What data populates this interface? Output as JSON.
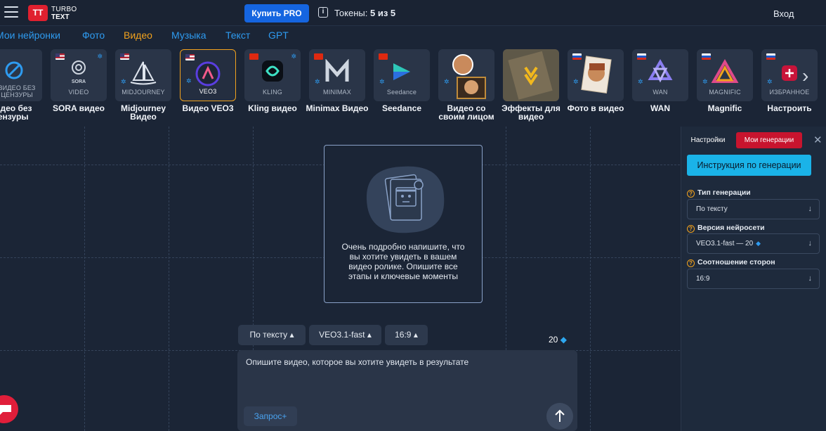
{
  "header": {
    "logo_mark": "TT",
    "logo_line1": "TURBO",
    "logo_line2": "TEXT",
    "buy_label": "Купить PRO",
    "tokens_label": "Токены:",
    "tokens_value": "5 из 5",
    "login_label": "Вход"
  },
  "categories": [
    {
      "label": "Мои нейронки",
      "active": false
    },
    {
      "label": "Фото",
      "active": false
    },
    {
      "label": "Видео",
      "active": true
    },
    {
      "label": "Музыка",
      "active": false
    },
    {
      "label": "Текст",
      "active": false
    },
    {
      "label": "GPT",
      "active": false
    }
  ],
  "tools": [
    {
      "tag": "ВИДЕО БЕЗ ЦЕНЗУРЫ",
      "label": "Видео без цензуры",
      "icon": "no-censor-icon"
    },
    {
      "tag": "VIDEO",
      "label": "SORA видео",
      "icon": "sora-icon"
    },
    {
      "tag": "MIDJOURNEY",
      "label": "Midjourney Видео",
      "icon": "midjourney-icon"
    },
    {
      "tag": "VEO3",
      "label": "Видео VEO3",
      "icon": "veo3-icon",
      "selected": true
    },
    {
      "tag": "KLING",
      "label": "Kling видео",
      "icon": "kling-icon"
    },
    {
      "tag": "MINIMAX",
      "label": "Minimax Видео",
      "icon": "minimax-icon"
    },
    {
      "tag": "Seedance",
      "label": "Seedance",
      "icon": "seedance-icon"
    },
    {
      "tag": "",
      "label": "Видео со своим лицом",
      "icon": "face-video-icon"
    },
    {
      "tag": "",
      "label": "Эффекты для видео",
      "icon": "effects-icon"
    },
    {
      "tag": "",
      "label": "Фото в видео",
      "icon": "photo-to-video-icon"
    },
    {
      "tag": "WAN",
      "label": "WAN",
      "icon": "wan-icon"
    },
    {
      "tag": "MAGNIFIC",
      "label": "Magnific",
      "icon": "magnific-icon"
    },
    {
      "tag": "ИЗБРАННОЕ",
      "label": "Настроить",
      "icon": "favorites-icon"
    }
  ],
  "sora_small": "SORA",
  "canvas": {
    "placeholder_text": "Очень подробно напишите, что вы хотите увидеть в вашем видео ролике. Опишите все этапы и ключевые моменты"
  },
  "composer": {
    "mode_pill": "По тексту",
    "model_pill": "VEO3.1-fast",
    "ratio_pill": "16:9",
    "cost": "20",
    "prompt_placeholder": "Опишите видео, которое вы хотите увидеть в результате",
    "request_label": "Запрос+"
  },
  "panel": {
    "tab_settings": "Настройки",
    "tab_generations": "Мои генерации",
    "guide_button": "Инструкция по генерации",
    "gen_type_label": "Тип генерации",
    "gen_type_value": "По тексту",
    "version_label": "Версия нейросети",
    "version_value": "VEO3.1-fast — 20",
    "ratio_label": "Соотношение сторон",
    "ratio_value": "16:9"
  },
  "colors": {
    "accent_orange": "#f2a21d",
    "link_blue": "#2e9bf0",
    "brand_red": "#e0202f",
    "buy_blue": "#1565e0",
    "guide_cyan": "#1ab3e8"
  }
}
